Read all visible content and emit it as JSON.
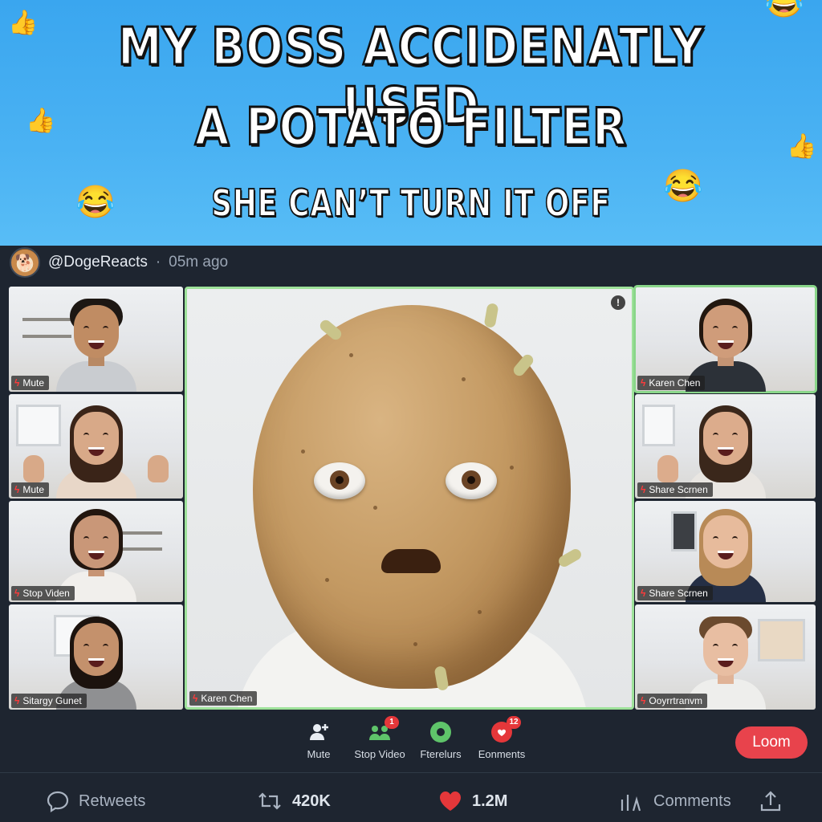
{
  "meme": {
    "line1": "MY BOSS ACCIDENATLY USED",
    "line2": "A POTATO FILTER",
    "line3": "SHE CAN’T TURN IT OFF"
  },
  "post": {
    "handle": "@DogeReacts",
    "separator": "·",
    "time": "05m ago"
  },
  "tiles": {
    "left": [
      {
        "label": "Mute"
      },
      {
        "label": "Mute"
      },
      {
        "label": "Stop Viden"
      },
      {
        "label": "Sitargy Gunet"
      }
    ],
    "right": [
      {
        "label": "Karen Chen"
      },
      {
        "label": "Share Scrnen"
      },
      {
        "label": "Share Scrnen"
      },
      {
        "label": "Ooyrrtranvm"
      }
    ],
    "center": {
      "label": "Karen Chen",
      "info": "!"
    }
  },
  "toolbar": {
    "mute": "Mute",
    "stop_video": "Stop Video",
    "stop_video_badge": "1",
    "participants": "Fterelurs",
    "comments": "Eonments",
    "comments_badge": "12",
    "leave": "Loom"
  },
  "actions": {
    "retweets_label": "Retweets",
    "retweet_count": "420K",
    "likes_count": "1.2M",
    "comments_label": "Comments"
  },
  "colors": {
    "banner": "#3aa6ef",
    "active_border": "#9ee29a",
    "leave": "#e8434c",
    "like": "#e5373a"
  }
}
